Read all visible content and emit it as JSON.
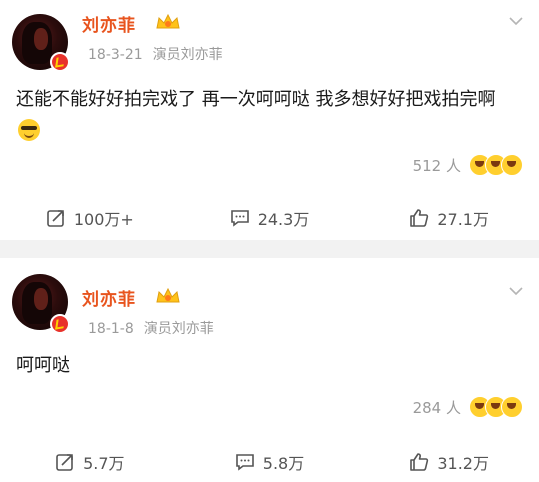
{
  "posts": [
    {
      "author": "刘亦菲",
      "date": "18-3-21",
      "source": "演员刘亦菲",
      "text": "还能不能好好拍完戏了 再一次呵呵哒 我多想好好把戏拍完啊",
      "reaction_count": "512 人",
      "repost_count": "100万+",
      "comment_count": "24.3万",
      "like_count": "27.1万"
    },
    {
      "author": "刘亦菲",
      "date": "18-1-8",
      "source": "演员刘亦菲",
      "text": "呵呵哒",
      "reaction_count": "284 人",
      "repost_count": "5.7万",
      "comment_count": "5.8万",
      "like_count": "31.2万"
    }
  ],
  "colors": {
    "name": "#e8541e",
    "verified": "#e8322b",
    "meta": "#9a9a9a",
    "separator": "#f2f2f2"
  },
  "icons": [
    "avatar",
    "verified-badge-icon",
    "crown-icon",
    "chevron-down-icon",
    "sunglasses-emoji-icon",
    "reaction-emoji-icon",
    "repost-icon",
    "comment-icon",
    "like-icon"
  ]
}
